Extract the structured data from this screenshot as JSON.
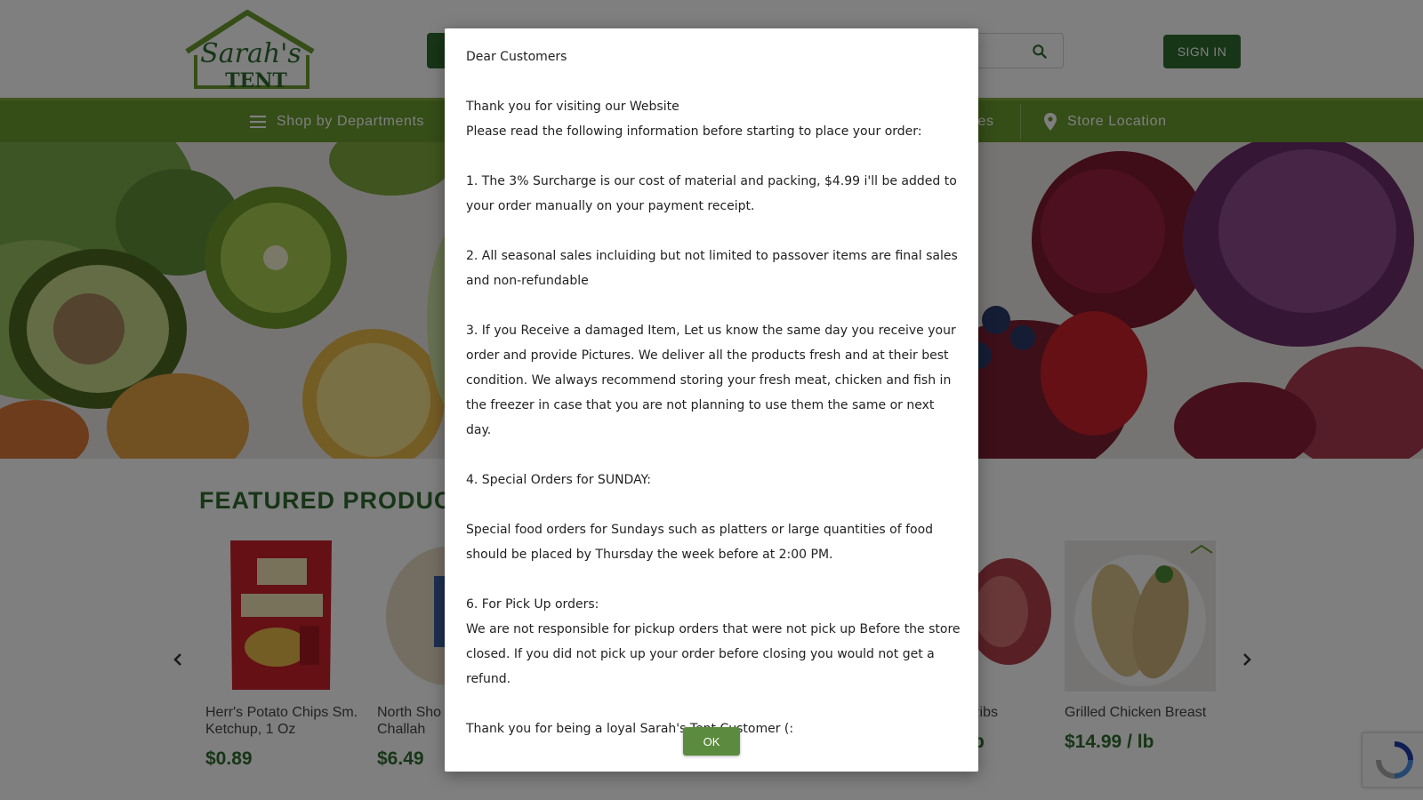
{
  "header": {
    "logo_text_top": "Sarah's",
    "logo_text_bottom": "TENT",
    "search_placeholder": "",
    "sign_in_label": "SIGN IN"
  },
  "nav": {
    "items": [
      {
        "label": "Shop by Departments",
        "icon": "menu-icon"
      },
      {
        "label": "pes",
        "icon": ""
      },
      {
        "label": "Store Location",
        "icon": "location-pin-icon"
      }
    ]
  },
  "featured": {
    "title": "FEATURED PRODUC",
    "products": [
      {
        "name": "Herr's Potato Chips Sm. Ketchup, 1 Oz",
        "price": "$0.89"
      },
      {
        "name": "North Sho\nChallah",
        "price": "$6.49"
      },
      {
        "name": "Ribs",
        "price": "b"
      },
      {
        "name": "Grilled Chicken Breast",
        "price": "$14.99 / lb"
      }
    ]
  },
  "modal": {
    "greeting": "Dear Customers",
    "line1": "Thank you for visiting our Website",
    "line2": "Please read the following information before starting to place your order:",
    "item1": "1. The 3% Surcharge is our cost of material and packing, $4.99 i'll be added to your order manually on your payment receipt.",
    "item2": "2. All seasonal sales incluiding but not limited to passover items are final sales and non-refundable",
    "item3": "3. If you Receive a damaged Item, Let us know the same day you receive your order and provide Pictures. We deliver all the products fresh and at their best condition. We always recommend storing your fresh meat, chicken and fish in the freezer in case that you are not planning to use them the same or next day.",
    "item4": "4. Special Orders for SUNDAY:",
    "item4_detail": "Special food orders for Sundays such as platters or large quantities of food should be placed by Thursday the week before at 2:00 PM.",
    "item6": "6. For Pick Up orders:",
    "item6_detail": "We are not responsible for pickup orders that were not pick up Before the store closed. If you did not pick up your order before closing you would not get a refund.",
    "closing": "Thank you for being a loyal Sarah's Tent Customer (:",
    "ok_label": "OK"
  },
  "colors": {
    "brand_green": "#2e6b2e",
    "nav_green": "#6b9a2f",
    "ok_green": "#5b8b3e"
  }
}
